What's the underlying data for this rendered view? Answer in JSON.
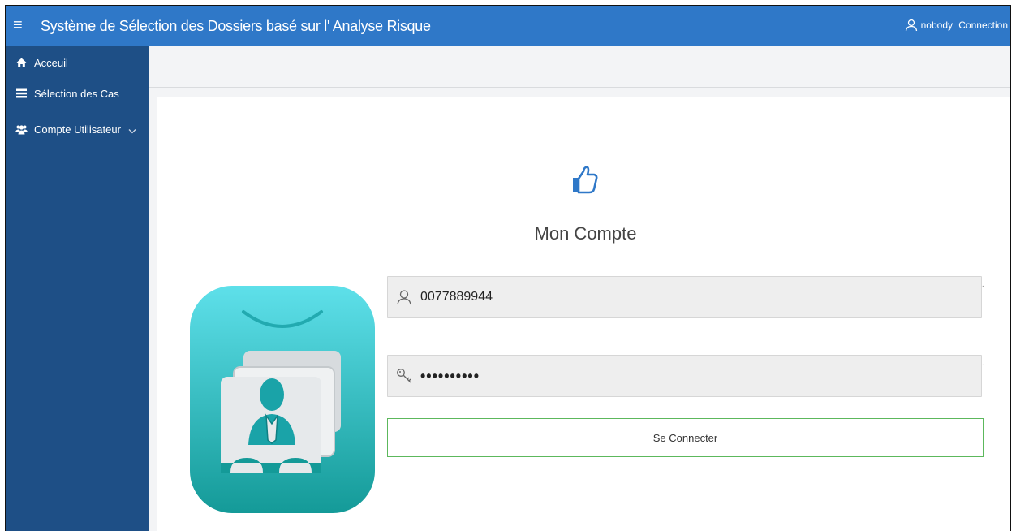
{
  "app": {
    "title": "Système de Sélection des Dossiers basé sur l' Analyse Risque",
    "menu_icon": "hamburger-icon"
  },
  "header": {
    "user": {
      "icon": "user-icon",
      "name": "nobody"
    },
    "connection_label": "Connection"
  },
  "sidebar": {
    "items": [
      {
        "icon": "home-icon",
        "label": "Acceuil"
      },
      {
        "icon": "list-icon",
        "label": "Sélection des Cas"
      },
      {
        "icon": "users-icon",
        "label": "Compte Utilisateur",
        "has_submenu": true
      }
    ]
  },
  "login": {
    "header_icon": "thumbs-up-icon",
    "title": "Mon Compte",
    "username": {
      "icon": "user-icon",
      "value": "0077889944"
    },
    "password": {
      "icon": "key-icon",
      "value": "••••••••••"
    },
    "submit_label": "Se Connecter",
    "illustration_icon": "user-card-icon"
  },
  "colors": {
    "topbar": "#2f78c8",
    "sidebar": "#1e4f86",
    "button_border": "#5cb85c",
    "tile_top": "#5ee0ea",
    "tile_bottom": "#149a98"
  }
}
